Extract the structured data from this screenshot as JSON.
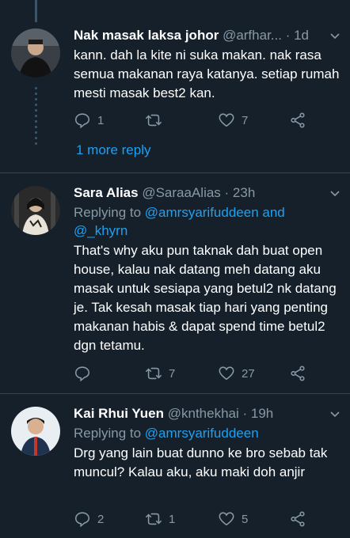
{
  "tweets": [
    {
      "name": "Nak masak laksa johor",
      "handle": "@arfhar...",
      "time": "· 1d",
      "reply_prefix": "",
      "reply_users": "",
      "text": "kann. dah la kite ni suka makan. nak rasa semua makanan raya katanya. setiap rumah mesti masak best2 kan.",
      "replies": "1",
      "retweets": "",
      "likes": "7",
      "more_reply": "1 more reply"
    },
    {
      "name": "Sara Alias",
      "handle": "@SaraaAlias · 23h",
      "reply_prefix": "Replying to ",
      "reply_users": "@amrsyarifuddeen and @_khyrn",
      "text": "That's why aku pun taknak dah buat open house, kalau nak datang meh datang aku masak untuk sesiapa yang betul2 nk datang je. Tak kesah masak tiap hari yang penting makanan habis & dapat spend time betul2 dgn tetamu.",
      "replies": "",
      "retweets": "7",
      "likes": "27"
    },
    {
      "name": "Kai Rhui Yuen",
      "handle": "@knthekhai · 19h",
      "reply_prefix": "Replying to ",
      "reply_users": "@amrsyarifuddeen",
      "text": "Drg yang lain buat dunno ke bro sebab tak muncul? Kalau aku, aku maki doh anjir",
      "replies": "2",
      "retweets": "1",
      "likes": "5"
    }
  ],
  "colors": {
    "background": "#15202b",
    "text": "#ffffff",
    "muted": "#8899a6",
    "link": "#1da1f2",
    "divider": "#38444d"
  },
  "icons": [
    "reply-icon",
    "retweet-icon",
    "like-icon",
    "share-icon",
    "chevron-down-icon"
  ]
}
